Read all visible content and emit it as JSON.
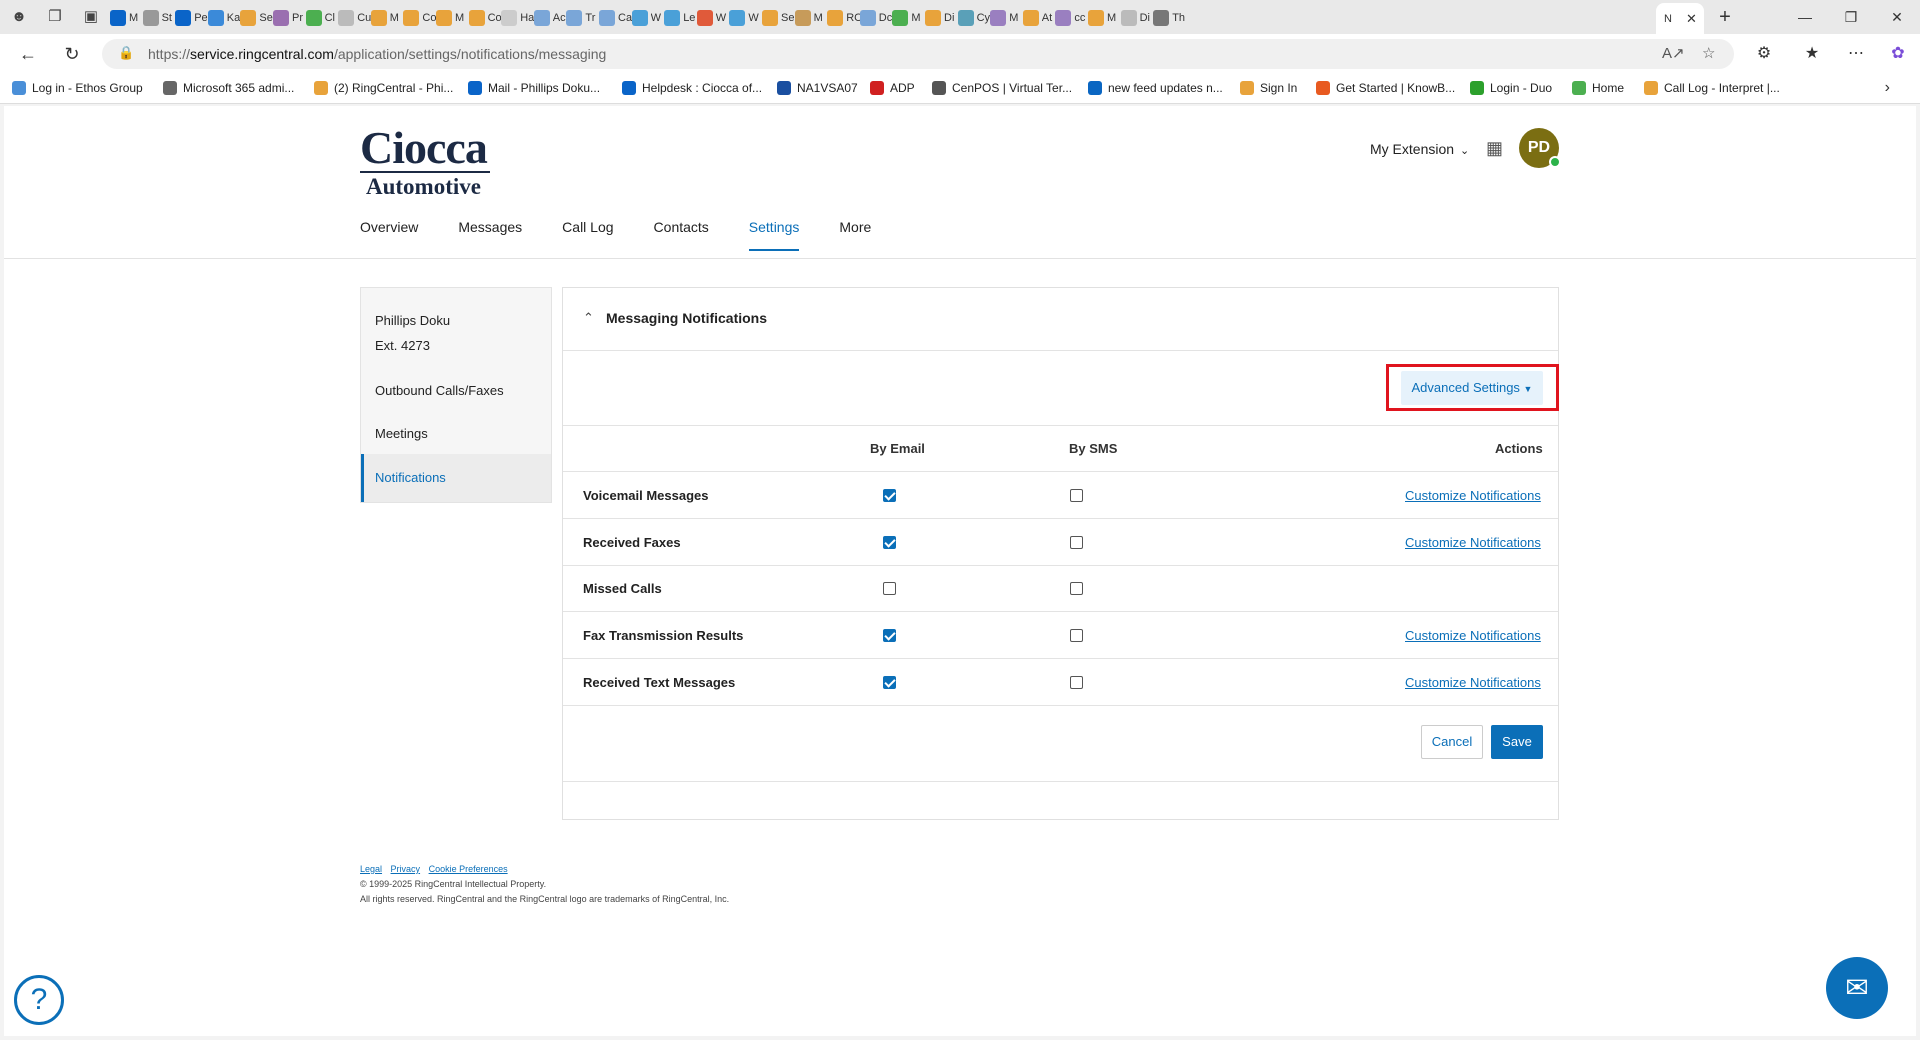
{
  "browser": {
    "url_prefix": "https://",
    "url_domain": "service.ringcentral.com",
    "url_path": "/application/settings/notifications/messaging",
    "active_tab_title": "N",
    "tabs": [
      "M",
      "St",
      "Pe",
      "Ka",
      "Se",
      "Pr",
      "Cl",
      "Cu",
      "M",
      "Co",
      "M",
      "Co",
      "Ha",
      "Ac",
      "Tr",
      "Ca",
      "W",
      "Le",
      "W",
      "W",
      "Se",
      "M",
      "RC",
      "Dc",
      "M",
      "Di",
      "Cy",
      "M",
      "At",
      "cc",
      "M",
      "Di",
      "Th"
    ],
    "bookmarks": [
      "Log in - Ethos Group",
      "Microsoft 365 admi...",
      "(2) RingCentral - Phi...",
      "Mail - Phillips Doku...",
      "Helpdesk : Ciocca of...",
      "NA1VSA07",
      "ADP",
      "CenPOS | Virtual Ter...",
      "new feed updates n...",
      "Sign In",
      "Get Started | KnowB...",
      "Login - Duo",
      "Home",
      "Call Log - Interpret |..."
    ]
  },
  "header": {
    "logo_line1": "Ciocca",
    "logo_line2": "Automotive",
    "my_extension": "My Extension",
    "avatar_initials": "PD"
  },
  "nav": [
    "Overview",
    "Messages",
    "Call Log",
    "Contacts",
    "Settings",
    "More"
  ],
  "sidebar": {
    "user_name": "Phillips Doku",
    "extension": "Ext. 4273",
    "items": [
      "Outbound Calls/Faxes",
      "Meetings",
      "Notifications"
    ]
  },
  "panel": {
    "title": "Messaging Notifications",
    "advanced_settings": "Advanced Settings",
    "columns": {
      "email": "By Email",
      "sms": "By SMS",
      "actions": "Actions"
    },
    "rows": [
      {
        "label": "Voicemail Messages",
        "email": true,
        "sms": false,
        "action": "Customize Notifications"
      },
      {
        "label": "Received Faxes",
        "email": true,
        "sms": false,
        "action": "Customize Notifications"
      },
      {
        "label": "Missed Calls",
        "email": false,
        "sms": false,
        "action": ""
      },
      {
        "label": "Fax Transmission Results",
        "email": true,
        "sms": false,
        "action": "Customize Notifications"
      },
      {
        "label": "Received Text Messages",
        "email": true,
        "sms": false,
        "action": "Customize Notifications"
      }
    ],
    "cancel": "Cancel",
    "save": "Save"
  },
  "footer": {
    "legal": "Legal",
    "privacy": "Privacy",
    "cookie": "Cookie Preferences",
    "copyright": "© 1999-2025 RingCentral Intellectual Property.",
    "rights": "All rights reserved. RingCentral and the RingCentral logo are trademarks of RingCentral, Inc."
  },
  "colors": {
    "accent": "#0b6fb8",
    "highlight": "#e0141e",
    "avatar": "#7b6e12"
  }
}
